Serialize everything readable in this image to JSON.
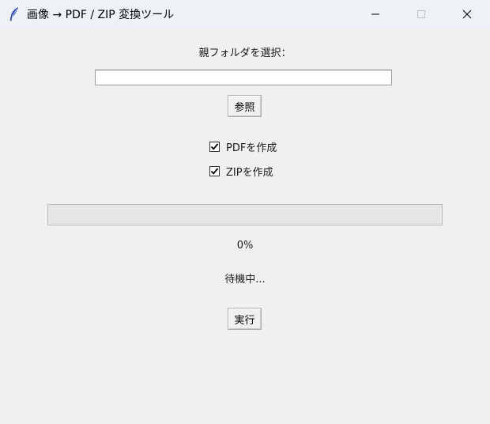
{
  "window": {
    "title": "画像 → PDF / ZIP 変換ツール",
    "icon": "feather-icon"
  },
  "form": {
    "parent_folder_label": "親フォルダを選択：",
    "path_value": "",
    "browse_label": "参照",
    "options": [
      {
        "label": "PDFを作成",
        "checked": true
      },
      {
        "label": "ZIPを作成",
        "checked": true
      }
    ]
  },
  "progress": {
    "value": 0,
    "percent_text": "0%"
  },
  "status": {
    "text": "待機中..."
  },
  "actions": {
    "run_label": "実行"
  },
  "colors": {
    "background": "#f0f0f0",
    "titlebar": "#eef2f7",
    "progress_track": "#e6e6e6",
    "progress_fill": "#06b025"
  }
}
